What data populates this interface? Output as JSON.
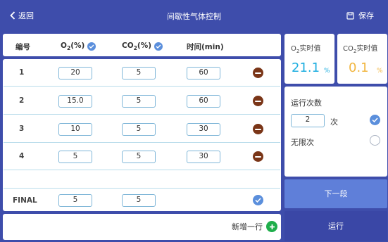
{
  "header": {
    "back_label": "返回",
    "title": "间歇性气体控制",
    "save_label": "保存"
  },
  "table": {
    "columns": {
      "id": "编号",
      "o2": "O",
      "co2": "CO",
      "time": "时间(min)",
      "o2_sub": "2",
      "co2_sub": "2",
      "unit": "(%)"
    },
    "rows": [
      {
        "label": "1",
        "o2": "20",
        "co2": "5",
        "time": "60"
      },
      {
        "label": "2",
        "o2": "15.0",
        "co2": "5",
        "time": "60"
      },
      {
        "label": "3",
        "o2": "10",
        "co2": "5",
        "time": "30"
      },
      {
        "label": "4",
        "o2": "5",
        "co2": "5",
        "time": "30"
      }
    ],
    "final": {
      "label": "FINAL",
      "o2": "5",
      "co2": "5"
    }
  },
  "add_row_label": "新增一行",
  "realtime": {
    "o2": {
      "label_pre": "O",
      "label_sub": "2",
      "label_post": "实时值",
      "value": "21.1",
      "unit": "%",
      "color": "#1eaee0"
    },
    "co2": {
      "label_pre": "CO",
      "label_sub": "2",
      "label_post": "实时值",
      "value": "0.1",
      "unit": "%",
      "color": "#f1b640"
    }
  },
  "run": {
    "title": "运行次数",
    "count": "2",
    "count_unit": "次",
    "unlimited_label": "无限次",
    "count_selected": true
  },
  "buttons": {
    "next": "下一段",
    "run": "运行"
  },
  "colors": {
    "header": "#3e4dab",
    "accent_check": "#5b8fdc",
    "delete": "#7a3517",
    "add": "#1fae4b",
    "next_btn": "#5f7fd9",
    "run_btn": "#3a47a6"
  }
}
